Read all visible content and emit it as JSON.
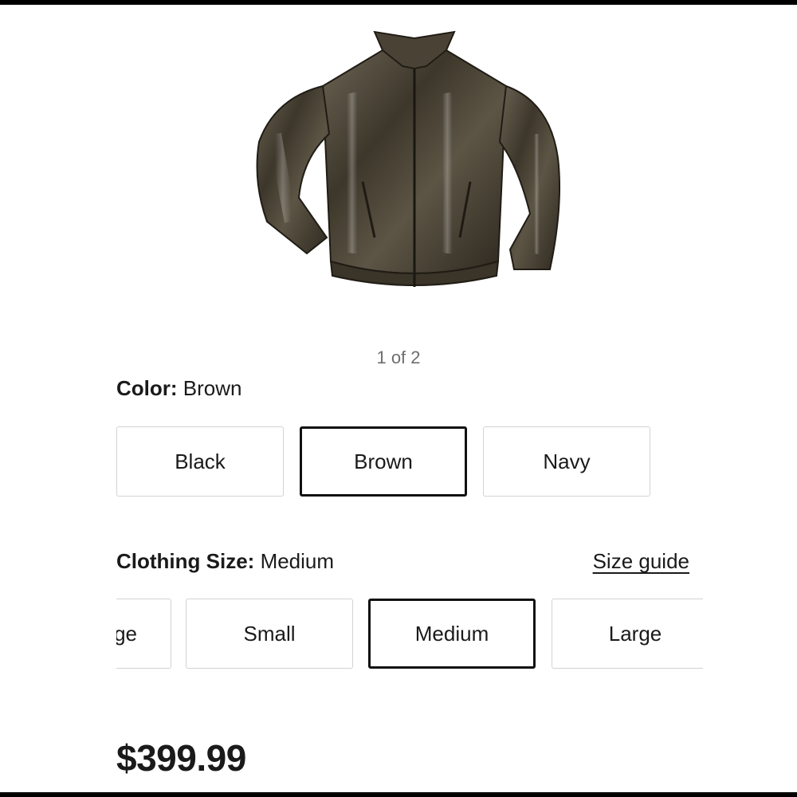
{
  "gallery": {
    "counter": "1 of 2"
  },
  "color": {
    "label": "Color:",
    "selected_value": "Brown",
    "options": [
      "Black",
      "Brown",
      "Navy"
    ]
  },
  "size": {
    "label": "Clothing Size:",
    "selected_value": "Medium",
    "guide_link": "Size guide",
    "options": [
      "ge",
      "Small",
      "Medium",
      "Large"
    ]
  },
  "price": "$399.99",
  "colors": {
    "text": "#1a1a1a",
    "muted": "#6d6e71",
    "border": "#d3d3d3",
    "selected_border": "#111111",
    "jacket_leather": "#4a4335"
  },
  "icons": {
    "product_image": "leather-jacket-image"
  }
}
